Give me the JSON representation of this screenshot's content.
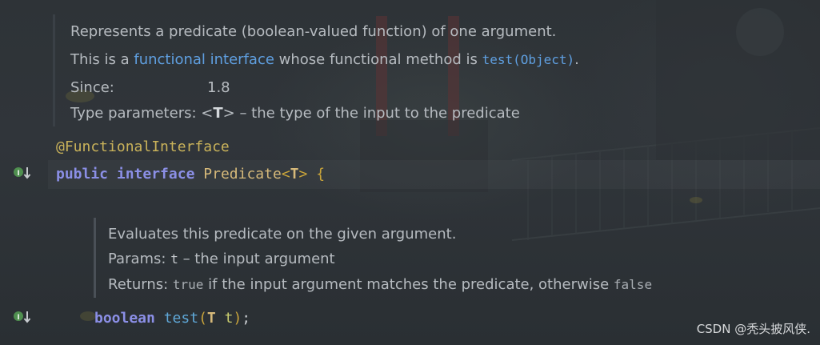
{
  "doc_top": {
    "line1": "Represents a predicate (boolean-valued function) of one argument.",
    "line2_pre": "This is a ",
    "line2_link": "functional interface",
    "line2_mid": " whose functional method is ",
    "line2_code": "test(Object)",
    "line2_end": ".",
    "since_label": "Since:",
    "since_value": "1.8",
    "typeparams_label": "Type parameters: ",
    "typeparams_lt": "<",
    "typeparams_T": "T",
    "typeparams_gt": ">",
    "typeparams_desc": " – the type of the input to the predicate"
  },
  "code": {
    "annotation": "@FunctionalInterface",
    "kw_public": "public",
    "kw_interface": "interface",
    "class_name": "Predicate",
    "type_open": "<",
    "type_param": "T",
    "type_close": ">",
    "brace": "{",
    "kw_boolean": "boolean",
    "method": "test",
    "paren_open": "(",
    "param_type": "T",
    "param_name": "t",
    "paren_close": ")",
    "semicolon": ";"
  },
  "doc_method": {
    "line1": "Evaluates this predicate on the given argument.",
    "params_label": "Params: ",
    "params_name": "t",
    "params_desc": " – the input argument",
    "returns_label": "Returns: ",
    "returns_true": "true",
    "returns_mid": " if the input argument matches the predicate, otherwise ",
    "returns_false": "false"
  },
  "gutter": {
    "icon1": "implemented-marker-icon",
    "icon2": "implemented-marker-icon"
  },
  "watermark": "CSDN @秃头披风侠."
}
